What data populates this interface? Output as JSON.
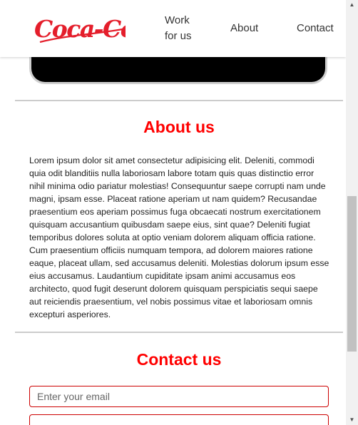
{
  "header": {
    "logo_text": "Coca-Cola",
    "nav": {
      "work_line1": "Work",
      "work_line2": "for us",
      "about": "About",
      "contact": "Contact"
    }
  },
  "about": {
    "title": "About us",
    "body": "Lorem ipsum dolor sit amet consectetur adipisicing elit. Deleniti, commodi quia odit blanditiis nulla laboriosam labore totam quis quas distinctio error nihil minima odio pariatur molestias! Consequuntur saepe corrupti nam unde magni, ipsam esse. Placeat ratione aperiam ut nam quidem? Recusandae praesentium eos aperiam possimus fuga obcaecati nostrum exercitationem quisquam accusantium quibusdam saepe eius, sint quae? Deleniti fugiat temporibus dolores soluta at optio veniam dolorem aliquam officia ratione. Cum praesentium officiis numquam tempora, ad dolorem maiores ratione eaque, placeat ullam, sed accusamus deleniti. Molestias dolorum ipsum esse eius accusamus. Laudantium cupiditate ipsam animi accusamus eos architecto, quod fugit deserunt dolorem quisquam perspiciatis sequi saepe aut reiciendis praesentium, vel nobis possimus vitae et laboriosam omnis excepturi asperiores."
  },
  "contact": {
    "title": "Contact us",
    "email_placeholder": "Enter your email",
    "email_value": "",
    "second_placeholder": ""
  },
  "colors": {
    "brand_red": "#ff0000",
    "field_border": "#cc0000",
    "divider": "#cccccc"
  }
}
